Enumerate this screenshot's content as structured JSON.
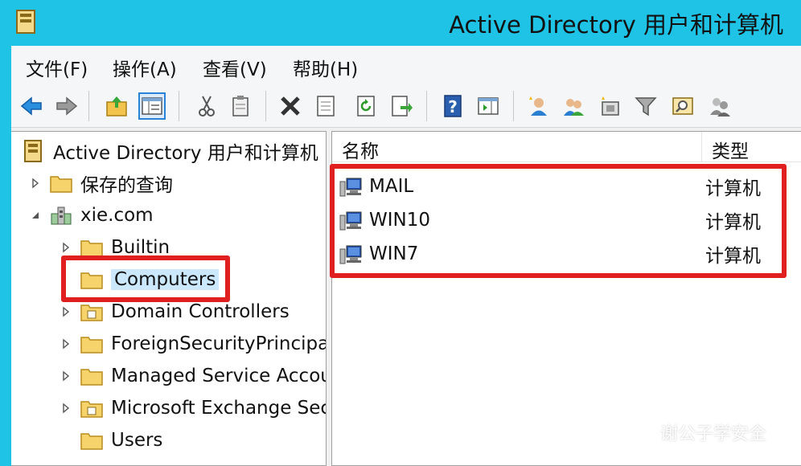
{
  "window": {
    "title": "Active Directory 用户和计算机"
  },
  "menu": [
    {
      "label": "文件(F)"
    },
    {
      "label": "操作(A)"
    },
    {
      "label": "查看(V)"
    },
    {
      "label": "帮助(H)"
    }
  ],
  "toolbar": {
    "buttons": [
      "back-icon",
      "forward-icon",
      "up-folder-icon",
      "show-tree-icon",
      "cut-icon",
      "clipboard-icon",
      "delete-icon",
      "properties-icon",
      "refresh-icon",
      "export-icon",
      "help-icon",
      "console-icon",
      "new-user-icon",
      "new-group-icon",
      "new-ou-icon",
      "filter-icon",
      "find-icon",
      "delegate-icon"
    ]
  },
  "tree": {
    "root": "Active Directory 用户和计算机",
    "saved_queries": "保存的查询",
    "domain": "xie.com",
    "children": [
      {
        "label": "Builtin"
      },
      {
        "label": "Computers"
      },
      {
        "label": "Domain Controllers"
      },
      {
        "label": "ForeignSecurityPrincipals"
      },
      {
        "label": "Managed Service Accounts"
      },
      {
        "label": "Microsoft Exchange Security Groups"
      },
      {
        "label": "Users"
      }
    ]
  },
  "list": {
    "columns": {
      "name": "名称",
      "type": "类型"
    },
    "rows": [
      {
        "name": "MAIL",
        "type": "计算机"
      },
      {
        "name": "WIN10",
        "type": "计算机"
      },
      {
        "name": "WIN7",
        "type": "计算机"
      }
    ]
  },
  "watermark": {
    "text": "谢公子学安全"
  },
  "colors": {
    "titlebar": "#1ec3e6",
    "highlight": "#e02020",
    "selection": "#cce8ff"
  }
}
